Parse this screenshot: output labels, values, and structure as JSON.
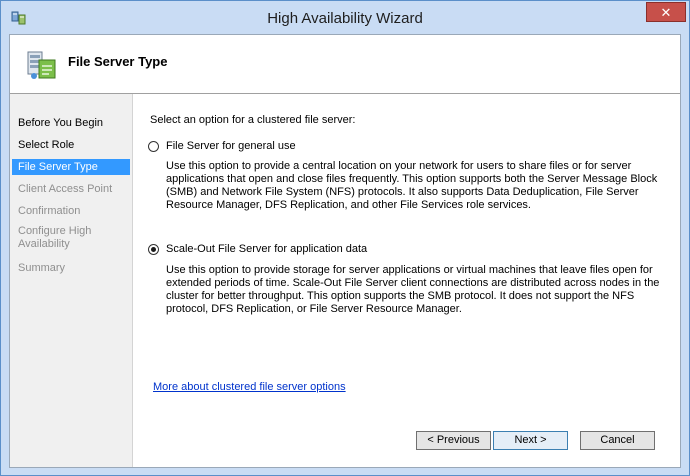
{
  "window": {
    "title": "High Availability Wizard",
    "close_glyph": "✕"
  },
  "header": {
    "title": "File Server Type"
  },
  "nav": {
    "items": [
      {
        "label": "Before You Begin",
        "state": "normal"
      },
      {
        "label": "Select Role",
        "state": "normal"
      },
      {
        "label": "File Server Type",
        "state": "current"
      },
      {
        "label": "Client Access Point",
        "state": "disabled"
      },
      {
        "label": "Confirmation",
        "state": "disabled"
      },
      {
        "label": "Configure High Availability",
        "state": "disabled"
      },
      {
        "label": "Summary",
        "state": "disabled"
      }
    ]
  },
  "main": {
    "prompt": "Select an option for a clustered file server:",
    "options": [
      {
        "label": "File Server for general use",
        "selected": false,
        "description": "Use this option to provide a central location on your network for users to share files or for server applications that open and close files frequently. This option supports both the Server Message Block (SMB) and Network File System (NFS) protocols. It also supports Data Deduplication, File Server Resource Manager, DFS Replication, and other File Services role services."
      },
      {
        "label": "Scale-Out File Server for application data",
        "selected": true,
        "description": "Use this option to provide storage for server applications or virtual machines that leave files open for extended periods of time. Scale-Out File Server client connections are distributed across nodes in the cluster for better throughput. This option supports the SMB protocol. It does not support the NFS protocol, DFS Replication, or File Server Resource Manager."
      }
    ],
    "more_link": "More about clustered file server options"
  },
  "buttons": {
    "previous": "< Previous",
    "next": "Next >",
    "cancel": "Cancel"
  },
  "colors": {
    "titlebar": "#c9dcf4",
    "nav_selected": "#3399ff",
    "close": "#c7504a",
    "link": "#0033cc"
  }
}
